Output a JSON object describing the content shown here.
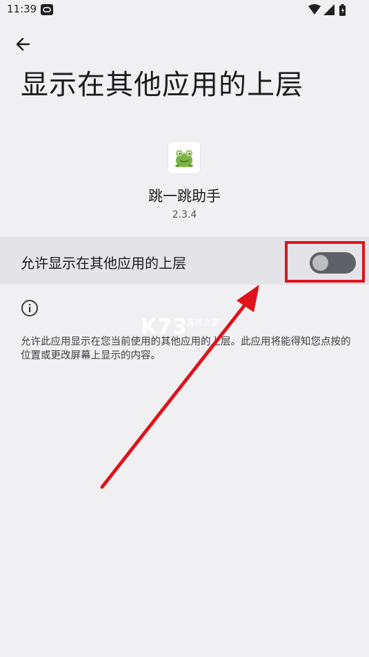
{
  "status_bar": {
    "time": "11:39"
  },
  "page": {
    "title": "显示在其他应用的上层"
  },
  "app": {
    "name": "跳一跳助手",
    "version": "2.3.4"
  },
  "permission_row": {
    "label": "允许显示在其他应用的上层",
    "switch_on": false
  },
  "info": {
    "description": "允许此应用显示在您当前使用的其他应用的上层。此应用将能得知您点按的位置或更改屏幕上显示的内容。"
  },
  "watermark": {
    "text": "K73",
    "sub": "游戏之家"
  },
  "colors": {
    "highlight": "#e0121a",
    "arrow": "#e0121a",
    "switch_track_off": "#5f6166"
  },
  "icons": [
    "app-link-icon",
    "wifi-icon",
    "signal-icon",
    "battery-icon",
    "back-arrow-icon",
    "frog-app-icon",
    "info-icon"
  ]
}
